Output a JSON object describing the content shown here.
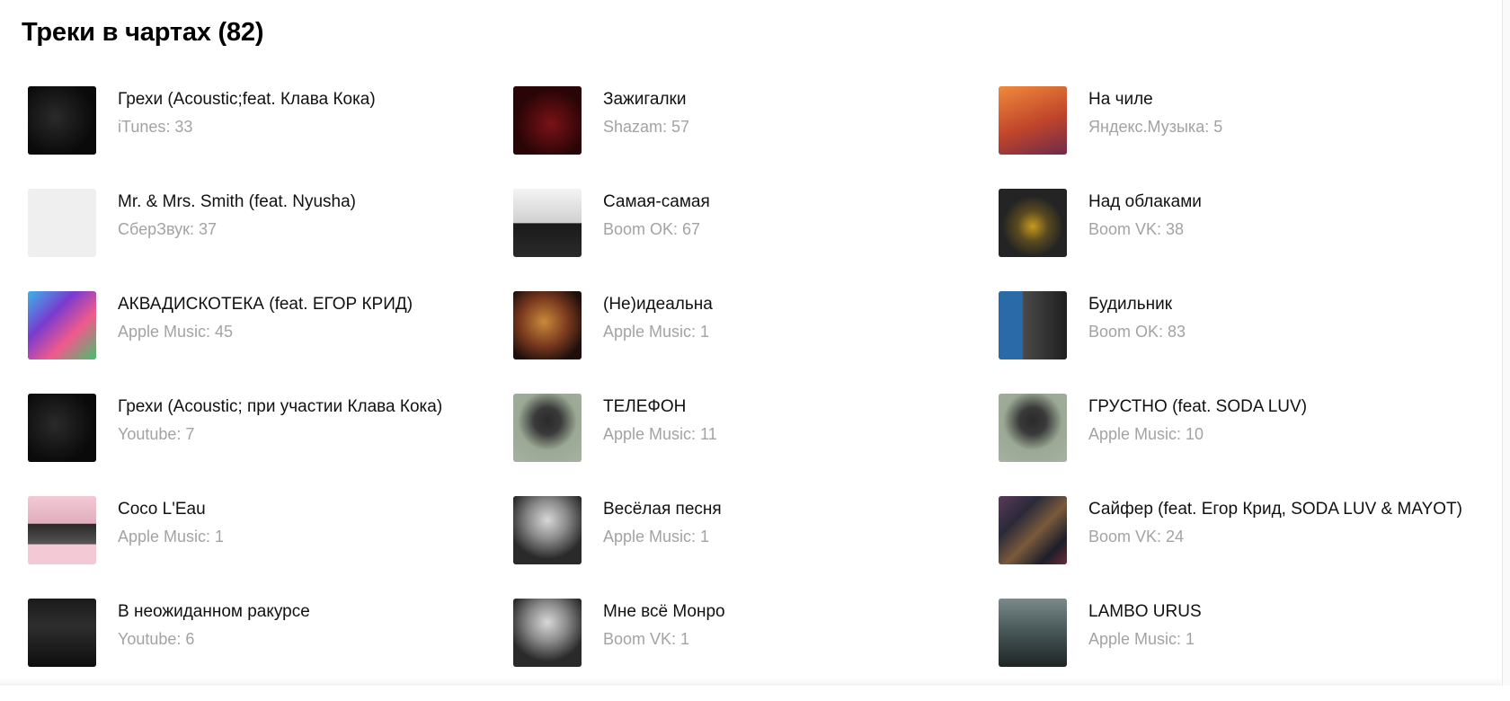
{
  "heading": "Треки в чартах (82)",
  "tracks": [
    {
      "title": "Грехи (Acoustic;feat. Клава Кока)",
      "chart": "iTunes: 33",
      "cover": "grekhi"
    },
    {
      "title": "Зажигалки",
      "chart": "Shazam: 57",
      "cover": "red"
    },
    {
      "title": "На чиле",
      "chart": "Яндекс.Музыка: 5",
      "cover": "orange"
    },
    {
      "title": "Mr. & Mrs. Smith (feat. Nyusha)",
      "chart": "СберЗвук: 37",
      "cover": "blank"
    },
    {
      "title": "Самая-самая",
      "chart": "Boom OK: 67",
      "cover": "white-suit"
    },
    {
      "title": "Над облаками",
      "chart": "Boom VK: 38",
      "cover": "blackstar"
    },
    {
      "title": "АКВАДИСКОТЕКА (feat. ЕГОР КРИД)",
      "chart": "Apple Music: 45",
      "cover": "colorful"
    },
    {
      "title": "(Не)идеальна",
      "chart": "Apple Music: 1",
      "cover": "mask"
    },
    {
      "title": "Будильник",
      "chart": "Boom OK: 83",
      "cover": "portrait-blue"
    },
    {
      "title": "Грехи (Acoustic; при участии Клава Кока)",
      "chart": "Youtube: 7",
      "cover": "grekhi"
    },
    {
      "title": "ТЕЛЕФОН",
      "chart": "Apple Music: 11",
      "cover": "sage"
    },
    {
      "title": "ГРУСТНО (feat. SODA LUV)",
      "chart": "Apple Music: 10",
      "cover": "sage"
    },
    {
      "title": "Coco L'Eau",
      "chart": "Apple Music: 1",
      "cover": "pink"
    },
    {
      "title": "Весёлая песня",
      "chart": "Apple Music: 1",
      "cover": "bw-portrait"
    },
    {
      "title": "Сайфер (feat. Егор Крид, SODA LUV & MAYOT)",
      "chart": "Boom VK: 24",
      "cover": "collage"
    },
    {
      "title": "В неожиданном ракурсе",
      "chart": "Youtube: 6",
      "cover": "phone"
    },
    {
      "title": "Мне всё Монро",
      "chart": "Boom VK: 1",
      "cover": "bw-portrait"
    },
    {
      "title": "LAMBO URUS",
      "chart": "Apple Music: 1",
      "cover": "car"
    }
  ],
  "cover_colors": {
    "grekhi": "#0d0d0d",
    "red": "#3a0a0c",
    "orange": "#d9642a",
    "blank": "#efefef",
    "white-suit": "#e6e6e6",
    "blackstar": "#2c2c2c",
    "colorful": "#2e6fb0",
    "mask": "#5a2a1a",
    "portrait-blue": "#3b4f66",
    "sage": "#8d9a86",
    "pink": "#e8b6c4",
    "bw-portrait": "#6b6b6b",
    "collage": "#3a2d3c",
    "phone": "#121212",
    "car": "#4d5a5a"
  },
  "colors": {
    "text": "#111111",
    "subtext": "#a3a3a3",
    "background": "#ffffff"
  }
}
